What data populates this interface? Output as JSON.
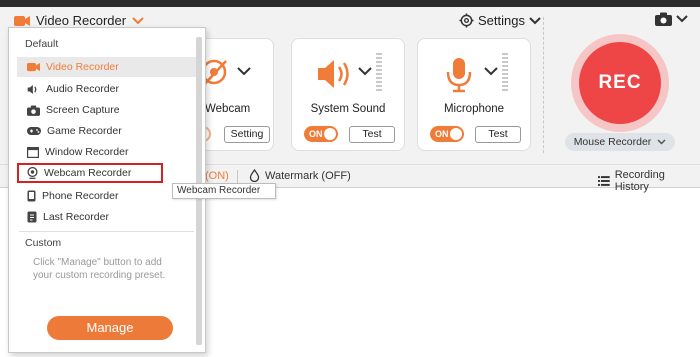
{
  "app": {
    "title": "Video Recorder",
    "settings_label": "Settings"
  },
  "menu": {
    "default_header": "Default",
    "items": [
      {
        "label": "Video Recorder",
        "icon": "video-camera-icon"
      },
      {
        "label": "Audio Recorder",
        "icon": "speaker-icon"
      },
      {
        "label": "Screen Capture",
        "icon": "camera-icon"
      },
      {
        "label": "Game Recorder",
        "icon": "gamepad-icon"
      },
      {
        "label": "Window Recorder",
        "icon": "window-icon"
      },
      {
        "label": "Webcam Recorder",
        "icon": "webcam-icon"
      },
      {
        "label": "Phone Recorder",
        "icon": "phone-icon"
      },
      {
        "label": "Last Recorder",
        "icon": "clock-icon"
      }
    ],
    "custom_header": "Custom",
    "custom_hint": "Click \"Manage\" button to add your custom recording preset.",
    "manage_label": "Manage"
  },
  "tooltip": "Webcam Recorder",
  "cards": {
    "webcam": {
      "label": "Webcam",
      "button": "Setting"
    },
    "system_sound": {
      "label": "System Sound",
      "toggle": "ON",
      "button": "Test"
    },
    "microphone": {
      "label": "Microphone",
      "toggle": "ON",
      "button": "Test"
    }
  },
  "rec": {
    "label": "REC",
    "mode": "Mouse Recorder"
  },
  "bottombar": {
    "partial_status": "(ON)",
    "watermark": "Watermark (OFF)",
    "history": "Recording History"
  },
  "colors": {
    "accent": "#f07c3a",
    "rec": "#ee4646",
    "highlight_box": "#d92020"
  }
}
